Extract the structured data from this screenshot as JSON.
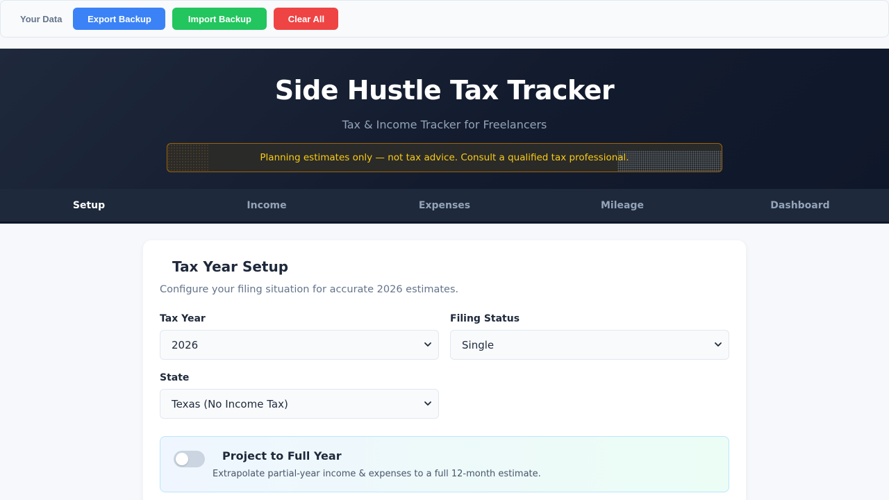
{
  "data_bar": {
    "label": "Your Data",
    "export_label": "Export Backup",
    "import_label": "Import Backup",
    "clear_label": "Clear All",
    "colors": {
      "export": "#3b82f6",
      "import": "#22c55e",
      "clear": "#ef4444"
    }
  },
  "header": {
    "title": "Side Hustle Tax Tracker",
    "subtitle": "Tax & Income Tracker for Freelancers",
    "notice": "Planning estimates only — not tax advice. Consult a qualified tax professional."
  },
  "tabs": [
    {
      "label": "Setup",
      "active": true
    },
    {
      "label": "Income",
      "active": false
    },
    {
      "label": "Expenses",
      "active": false
    },
    {
      "label": "Mileage",
      "active": false
    },
    {
      "label": "Dashboard",
      "active": false
    }
  ],
  "setup": {
    "title": "Tax Year Setup",
    "description": "Configure your filing situation for accurate 2026 estimates.",
    "tax_year": {
      "label": "Tax Year",
      "value": "2026"
    },
    "filing_status": {
      "label": "Filing Status",
      "value": "Single"
    },
    "state": {
      "label": "State",
      "value": "Texas (No Income Tax)"
    },
    "projection": {
      "title": "Project to Full Year",
      "description": "Extrapolate partial-year income & expenses to a full 12-month estimate.",
      "enabled": false
    }
  },
  "icons": {
    "select_arrow": "chevron-down-icon"
  }
}
